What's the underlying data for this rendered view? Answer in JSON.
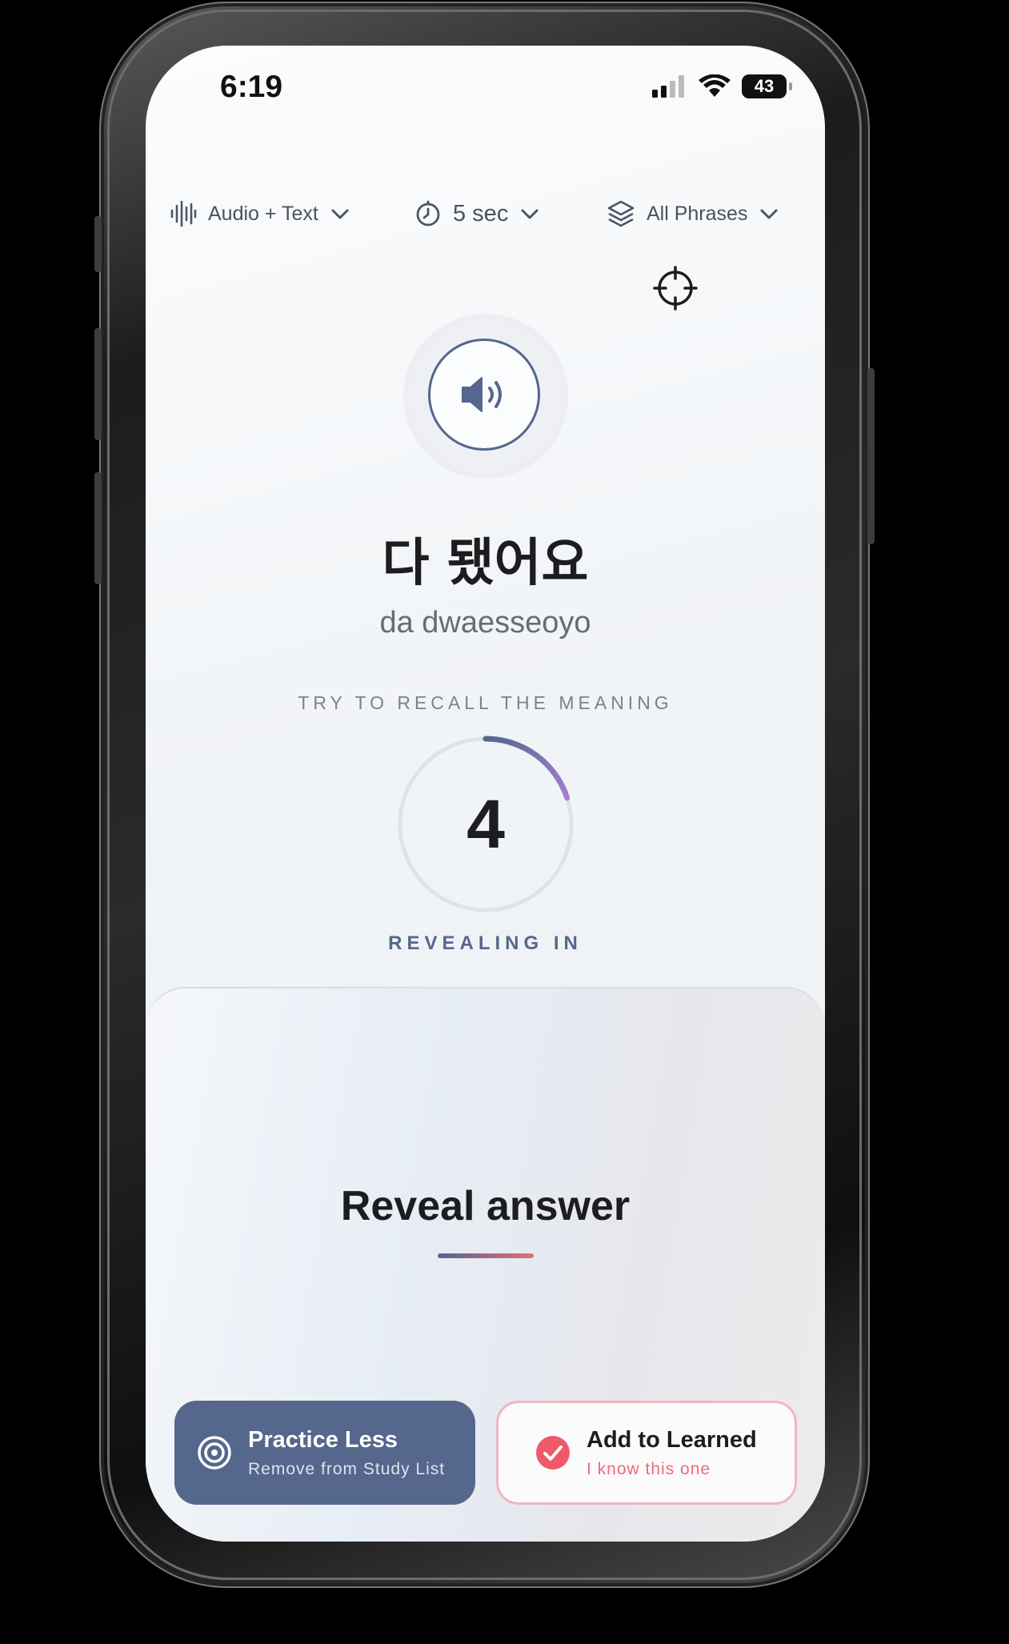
{
  "status_bar": {
    "time": "6:19",
    "battery": "43"
  },
  "toolbar": {
    "mode_label": "Audio + Text",
    "mode_icon": "waveform-icon",
    "timer_label": "5 sec",
    "timer_icon": "timer-icon",
    "filter_label": "All Phrases",
    "filter_icon": "layers-icon"
  },
  "phrase": {
    "korean": "다 됐어요",
    "romanization": "da dwaesseoyo"
  },
  "prompt": "TRY TO RECALL THE MEANING",
  "countdown": {
    "value": "4",
    "label": "REVEALING IN",
    "progress": 0.2
  },
  "reveal": {
    "label": "Reveal answer"
  },
  "actions": {
    "practice_less": {
      "title": "Practice Less",
      "subtitle": "Remove from Study List"
    },
    "add_learned": {
      "title": "Add to Learned",
      "subtitle": "I know this one"
    }
  },
  "colors": {
    "accent": "#55678d",
    "danger": "#ef5a68",
    "purple": "#9b7fc0"
  }
}
